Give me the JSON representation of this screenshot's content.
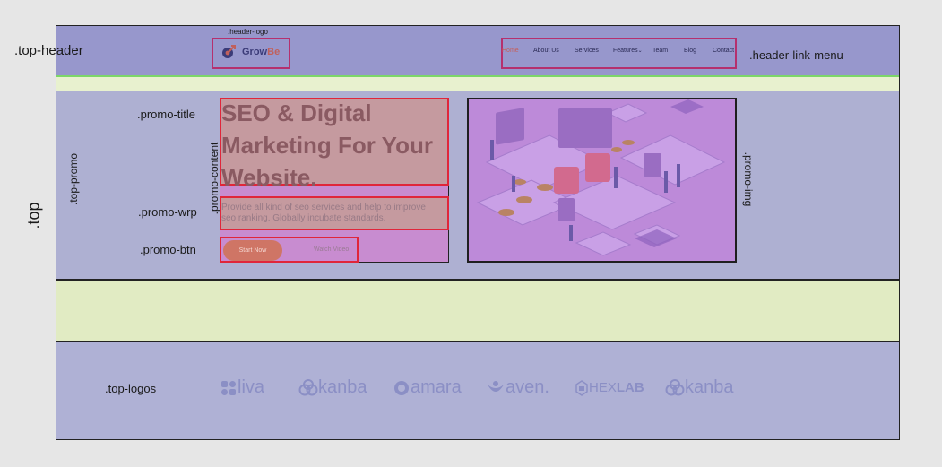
{
  "annotations": {
    "top_header": ".top-header",
    "header_logo": ".header-logo",
    "header_link_menu": ".header-link-menu",
    "top": ".top",
    "top_promo": ".top-promo",
    "promo_title": ".promo-title",
    "promo_wrp": ".promo-wrp",
    "promo_btn": ".promo-btn",
    "promo_content": ".promo-content",
    "promo_img": ".promo-img",
    "top_logos": ".top-logos"
  },
  "header": {
    "logo_part1": "Grow",
    "logo_part2": "Be",
    "nav": [
      "Home",
      "About Us",
      "Services",
      "Features",
      "Team",
      "Blog",
      "Contact"
    ],
    "features_caret": "⌄"
  },
  "promo": {
    "title_lines": [
      "SEO & Digital",
      "Marketing For Your",
      "Website."
    ],
    "description_lines": [
      "Provide all kind of seo services and help to improve",
      "seo ranking. Globally incubate standards."
    ],
    "btn_primary": "Start Now",
    "btn_secondary": "Watch Video"
  },
  "logos": [
    "liva",
    "kanba",
    "amara",
    "aven.",
    "HEX",
    "LAB",
    "kanba"
  ],
  "colors": {
    "header_bg": "#9797cc",
    "promo_bg": "#aeb0d2",
    "gap_bg": "#e1ebc3",
    "highlight_border": "#e0263a",
    "menu_border": "#b5306e",
    "accent": "#c65e5a"
  }
}
